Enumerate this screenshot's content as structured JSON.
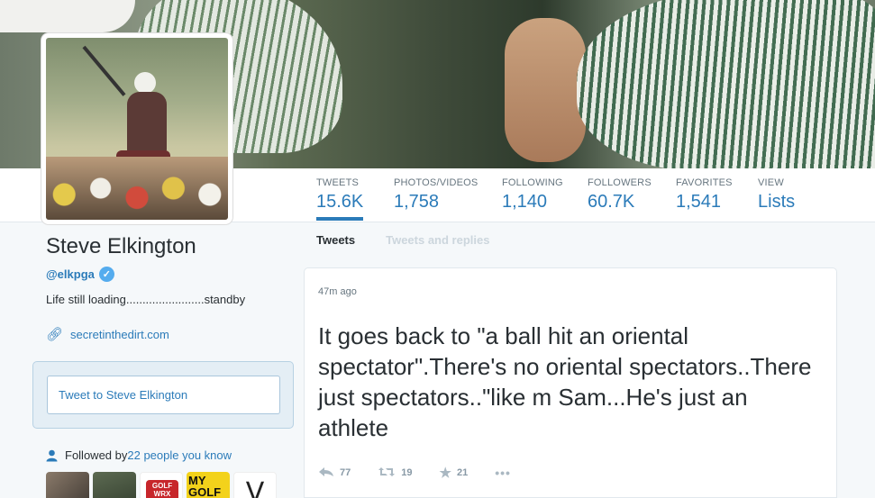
{
  "profile": {
    "name": "Steve Elkington",
    "screen_name": "@elkpga",
    "bio": "Life still loading........................standby",
    "url": "secretinthedirt.com"
  },
  "stats": [
    {
      "label": "TWEETS",
      "value": "15.6K"
    },
    {
      "label": "PHOTOS/VIDEOS",
      "value": "1,758"
    },
    {
      "label": "FOLLOWING",
      "value": "1,140"
    },
    {
      "label": "FOLLOWERS",
      "value": "60.7K"
    },
    {
      "label": "FAVORITES",
      "value": "1,541"
    },
    {
      "label": "VIEW",
      "value": "Lists"
    }
  ],
  "tabs": {
    "tweets": "Tweets",
    "replies": "Tweets and replies"
  },
  "tweet_box": {
    "placeholder": "Tweet to Steve Elkington"
  },
  "followed_by": {
    "prefix": "Followed by ",
    "link": "22 people you know"
  },
  "thumbs": {
    "golf_wrx": "GOLF WRX",
    "my_golf": "MY GOLF",
    "v_logo": "V"
  },
  "tweet": {
    "time": "47m ago",
    "text": "It goes back to \"a ball hit an oriental spectator\".There's no oriental spectators..There just spectators..\"like m Sam...He's just an athlete",
    "replies": "77",
    "retweets": "19",
    "favorites": "21",
    "more": "•••"
  },
  "icons": {
    "reply": "reply-icon",
    "retweet": "retweet-icon",
    "favorite": "star-icon",
    "link": "link-icon",
    "person": "person-icon",
    "verified": "verified-badge-icon"
  },
  "colors": {
    "accent": "#2b7bb9",
    "verified": "#55acee"
  }
}
